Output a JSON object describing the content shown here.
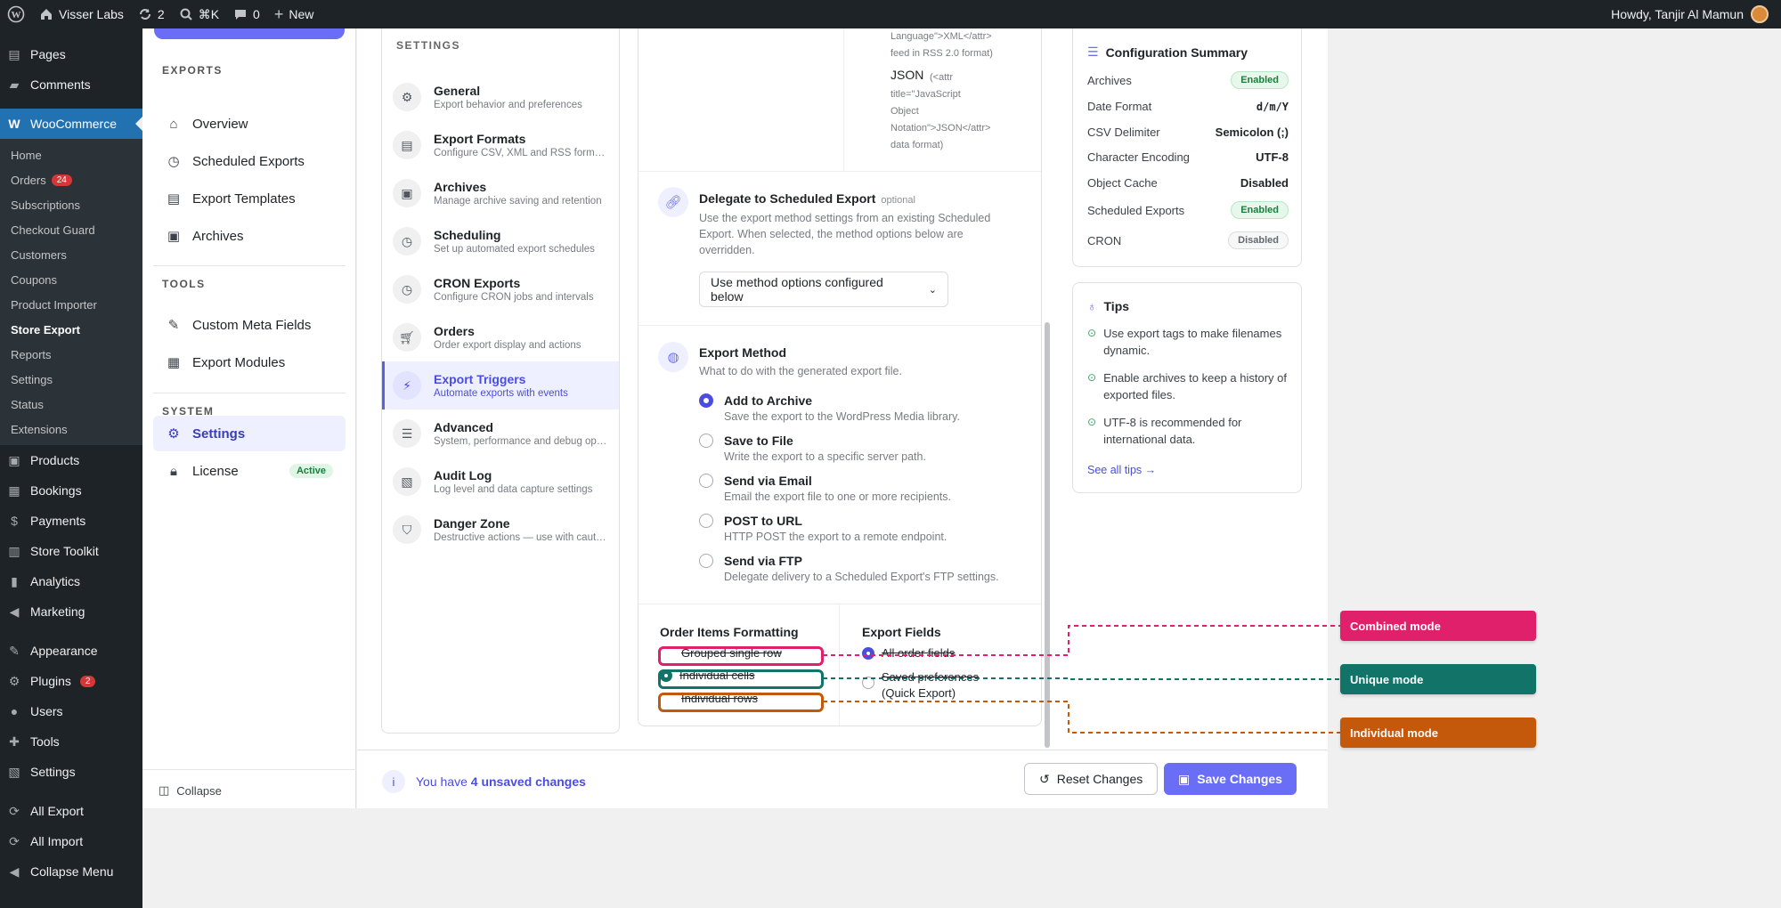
{
  "adminbar": {
    "site_name": "Visser Labs",
    "updates": "2",
    "search": "⌘K",
    "comments": "0",
    "new_label": "New",
    "howdy": "Howdy, Tanjir Al Mamun"
  },
  "wp_menu": {
    "pages": "Pages",
    "comments": "Comments",
    "woocommerce": "WooCommerce",
    "woo_sub": {
      "home": "Home",
      "orders": "Orders",
      "orders_count": "24",
      "subscriptions": "Subscriptions",
      "checkout_guard": "Checkout Guard",
      "customers": "Customers",
      "coupons": "Coupons",
      "product_importer": "Product Importer",
      "store_export": "Store Export",
      "reports": "Reports",
      "settings": "Settings",
      "status": "Status",
      "extensions": "Extensions"
    },
    "products": "Products",
    "bookings": "Bookings",
    "payments": "Payments",
    "store_toolkit": "Store Toolkit",
    "analytics": "Analytics",
    "marketing": "Marketing",
    "appearance": "Appearance",
    "plugins": "Plugins",
    "plugins_count": "2",
    "users": "Users",
    "tools": "Tools",
    "settings": "Settings",
    "all_export": "All Export",
    "all_import": "All Import",
    "collapse": "Collapse Menu"
  },
  "plugin_nav": {
    "exports_heading": "EXPORTS",
    "overview": "Overview",
    "scheduled_exports": "Scheduled Exports",
    "export_templates": "Export Templates",
    "archives": "Archives",
    "tools_heading": "TOOLS",
    "custom_meta_fields": "Custom Meta Fields",
    "export_modules": "Export Modules",
    "system_heading": "SYSTEM",
    "settings": "Settings",
    "license": "License",
    "license_badge": "Active",
    "collapse": "Collapse"
  },
  "settings_list": {
    "heading": "SETTINGS",
    "items": [
      {
        "title": "General",
        "desc": "Export behavior and preferences",
        "icon": "gear-icon"
      },
      {
        "title": "Export Formats",
        "desc": "Configure CSV, XML and RSS formats",
        "icon": "document-icon"
      },
      {
        "title": "Archives",
        "desc": "Manage archive saving and retention",
        "icon": "archive-icon"
      },
      {
        "title": "Scheduling",
        "desc": "Set up automated export schedules",
        "icon": "clock-icon"
      },
      {
        "title": "CRON Exports",
        "desc": "Configure CRON jobs and intervals",
        "icon": "clock-icon"
      },
      {
        "title": "Orders",
        "desc": "Order export display and actions",
        "icon": "cart-icon"
      },
      {
        "title": "Export Triggers",
        "desc": "Automate exports with events",
        "icon": "lightning-icon"
      },
      {
        "title": "Advanced",
        "desc": "System, performance and debug options",
        "icon": "sliders-icon"
      },
      {
        "title": "Audit Log",
        "desc": "Log level and data capture settings",
        "icon": "log-icon"
      },
      {
        "title": "Danger Zone",
        "desc": "Destructive actions — use with caution",
        "icon": "shield-icon"
      }
    ]
  },
  "main": {
    "xml_tail_1": "Language\">XML</attr>",
    "xml_tail_2": "feed in RSS 2.0 format)",
    "json_label": "JSON",
    "json_desc_1": "(<attr",
    "json_desc_2": "title=\"JavaScript",
    "json_desc_3": "Object",
    "json_desc_4": "Notation\">JSON</attr>",
    "json_desc_5": "data format)",
    "delegate_title": "Delegate to Scheduled Export",
    "delegate_optional": "optional",
    "delegate_desc_1": "Use the export method settings from an existing Scheduled",
    "delegate_desc_2": "Export. When selected, the method options below are",
    "delegate_desc_3": "overridden.",
    "delegate_select": "Use method options configured below",
    "method_title": "Export Method",
    "method_desc": "What to do with the generated export file.",
    "methods": [
      {
        "label": "Add to Archive",
        "desc": "Save the export to the WordPress Media library."
      },
      {
        "label": "Save to File",
        "desc": "Write the export to a specific server path."
      },
      {
        "label": "Send via Email",
        "desc": "Email the export file to one or more recipients."
      },
      {
        "label": "POST to URL",
        "desc": "HTTP POST the export to a remote endpoint."
      },
      {
        "label": "Send via FTP",
        "desc": "Delegate delivery to a Scheduled Export's FTP settings."
      }
    ],
    "selected_method": "Add to Archive",
    "order_items_title": "Order Items Formatting",
    "order_items": [
      "Grouped single row",
      "Individual cells",
      "Individual rows"
    ],
    "export_fields_title": "Export Fields",
    "export_fields": [
      "All order fields",
      "Saved preferences",
      "(Quick Export)"
    ]
  },
  "summary": {
    "title": "Configuration Summary",
    "rows": [
      {
        "k": "Archives",
        "v": "Enabled",
        "kind": "enabled"
      },
      {
        "k": "Date Format",
        "v": "d/m/Y",
        "kind": "text"
      },
      {
        "k": "CSV Delimiter",
        "v": "Semicolon (;)",
        "kind": "text"
      },
      {
        "k": "Character Encoding",
        "v": "UTF-8",
        "kind": "text"
      },
      {
        "k": "Object Cache",
        "v": "Disabled",
        "kind": "text"
      },
      {
        "k": "Scheduled Exports",
        "v": "Enabled",
        "kind": "enabled"
      },
      {
        "k": "CRON",
        "v": "Disabled",
        "kind": "disabled"
      }
    ]
  },
  "tips": {
    "title": "Tips",
    "items": [
      {
        "l1": "Use export tags to make filenames",
        "l2": "dynamic."
      },
      {
        "l1": "Enable archives to keep a history of",
        "l2": "exported files."
      },
      {
        "l1": "UTF-8 is recommended for",
        "l2": "international data."
      }
    ],
    "see_all": "See all tips →"
  },
  "footer": {
    "msg_prefix": "You have",
    "msg_count": "4 unsaved changes",
    "reset": "Reset Changes",
    "save": "Save Changes"
  },
  "annotations": {
    "combined": "Combined mode",
    "unique": "Unique mode",
    "individual": "Individual mode"
  },
  "colors": {
    "accent": "#6a6ef7",
    "wp_blue": "#2271b1",
    "combined": "#e0206a",
    "unique": "#127468",
    "individual": "#c4580b"
  }
}
